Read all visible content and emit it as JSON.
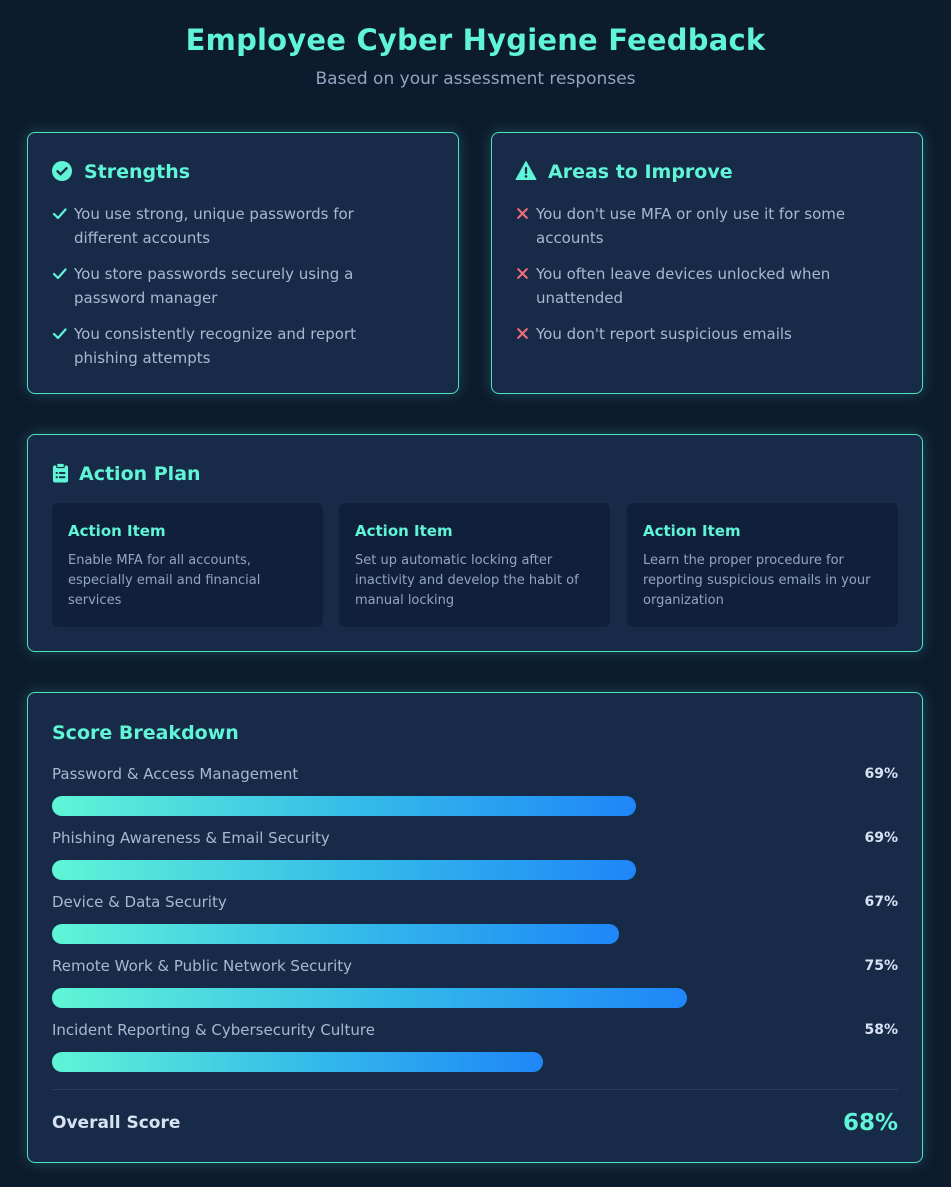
{
  "header": {
    "title": "Employee Cyber Hygiene Feedback",
    "subtitle": "Based on your assessment responses"
  },
  "strengths": {
    "title": "Strengths",
    "icon": "check-circle-icon",
    "items": [
      "You use strong, unique passwords for different accounts",
      "You store passwords securely using a password manager",
      "You consistently recognize and report phishing attempts"
    ]
  },
  "improve": {
    "title": "Areas to Improve",
    "icon": "warning-triangle-icon",
    "items": [
      "You don't use MFA or only use it for some accounts",
      "You often leave devices unlocked when unattended",
      "You don't report suspicious emails"
    ]
  },
  "action_plan": {
    "title": "Action Plan",
    "icon": "clipboard-icon",
    "items": [
      {
        "title": "Action Item",
        "text": "Enable MFA for all accounts, especially email and financial services"
      },
      {
        "title": "Action Item",
        "text": "Set up automatic locking after inactivity and develop the habit of manual locking"
      },
      {
        "title": "Action Item",
        "text": "Learn the proper procedure for reporting suspicious emails in your organization"
      }
    ]
  },
  "score_breakdown": {
    "title": "Score Breakdown",
    "rows": [
      {
        "label": "Password & Access Management",
        "value": "69%",
        "fraction": 0.69
      },
      {
        "label": "Phishing Awareness & Email Security",
        "value": "69%",
        "fraction": 0.69
      },
      {
        "label": "Device & Data Security",
        "value": "67%",
        "fraction": 0.67
      },
      {
        "label": "Remote Work & Public Network Security",
        "value": "75%",
        "fraction": 0.75
      },
      {
        "label": "Incident Reporting & Cybersecurity Culture",
        "value": "58%",
        "fraction": 0.58
      }
    ],
    "overall_label": "Overall Score",
    "overall_value": "68%"
  },
  "colors": {
    "accent": "#5ff5d6",
    "background": "#0d1b2e",
    "card": "#172a47",
    "check": "#5ff5d6",
    "cross": "#f06b7a",
    "bar_start": "#5ff5d6",
    "bar_end": "#1f86f8"
  }
}
